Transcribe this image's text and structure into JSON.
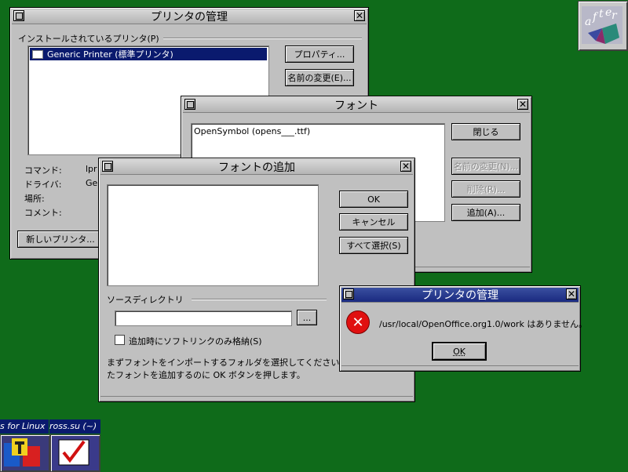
{
  "printer_admin": {
    "title": "プリンタの管理",
    "installed_label": "インストールされているプリンタ(P)",
    "printers": [
      "Generic Printer (標準プリンタ)"
    ],
    "properties_button": "プロパティ...",
    "rename_button": "名前の変更(E)...",
    "command_label": "コマンド:",
    "command_value": "lpr",
    "driver_label": "ドライバ:",
    "driver_value": "Ger",
    "location_label": "場所:",
    "comment_label": "コメント:",
    "new_printer_button": "新しいプリンタ..."
  },
  "fonts": {
    "title": "フォント",
    "items": [
      "OpenSymbol (opens___.ttf)"
    ],
    "close_button": "閉じる",
    "rename_button": "名前の変更(N)...",
    "delete_button": "削除(R)...",
    "add_button": "追加(A)..."
  },
  "add_font": {
    "title": "フォントの追加",
    "ok_button": "OK",
    "cancel_button": "キャンセル",
    "select_all_button": "すべて選択(S)",
    "source_dir_label": "ソースディレクトリ",
    "source_dir_value": "",
    "browse_button": "...",
    "symlink_checkbox_label": "追加時にソフトリンクのみ格納(S)",
    "symlink_checked": false,
    "info_line1": "まずフォントをインポートするフォルダを選択してください",
    "info_line2": "たフォントを追加するのに OK ボタンを押します。"
  },
  "error_dialog": {
    "title": "プリンタの管理",
    "message": "/usr/local/OpenOffice.org1.0/work はありません。",
    "ok_button": "OK"
  },
  "taskbar": {
    "task1_label": "s for Linux",
    "task2_label": "ross.su (~)"
  },
  "colors": {
    "desktop": "#0f6b1a",
    "selection": "#0a1a6e",
    "active_title": "#1a2a80",
    "error_icon": "#e01010"
  }
}
